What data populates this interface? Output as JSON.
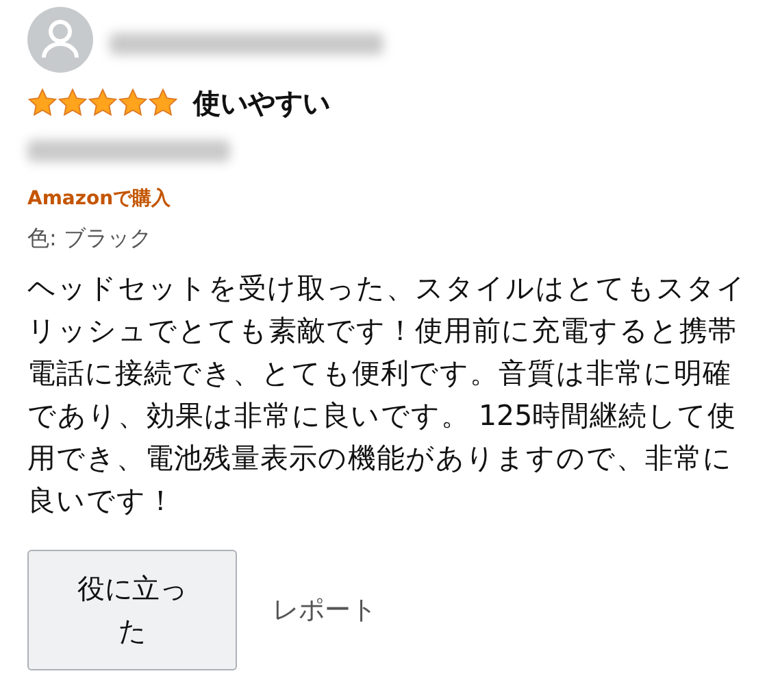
{
  "review": {
    "stars": 5,
    "title": "使いやすい",
    "badge": "Amazonで購入",
    "variant": "色: ブラック",
    "body": "ヘッドセットを受け取った、スタイルはとてもスタイリッシュでとても素敵です！使用前に充電すると携帯電話に接続でき、とても便利です。音質は非常に明確であり、効果は非常に良いです。 125時間継続して使用でき、電池残量表示の機能がありますので、非常に良いです！"
  },
  "buttons": {
    "helpful": "役に立った",
    "report": "レポート"
  }
}
